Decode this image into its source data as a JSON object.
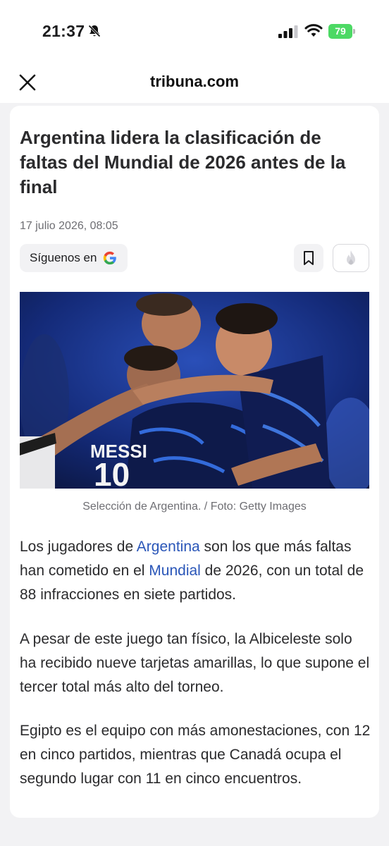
{
  "status_bar": {
    "time": "21:37",
    "battery": "79",
    "icons": [
      "bell-muted-icon",
      "cellular-signal-icon",
      "wifi-icon",
      "battery-charging-icon"
    ]
  },
  "header": {
    "close_icon": "close-icon",
    "site": "tribuna.com"
  },
  "article": {
    "title": "Argentina lidera la clasificación de faltas del Mundial de 2026 antes de la final",
    "date": "17 julio 2026, 08:05",
    "follow_label": "Síguenos en",
    "follow_icon": "google-icon",
    "bookmark_icon": "bookmark-icon",
    "reaction_icon": "fire-icon",
    "image_caption": "Selección de Argentina. / Foto: Getty Images",
    "paragraphs": {
      "p1": {
        "t1": "Los jugadores de ",
        "link1": "Argentina",
        "t2": " son los que más faltas han cometido en el ",
        "link2": "Mundial",
        "t3": " de 2026, con un total de 88 infracciones en siete partidos."
      },
      "p2": "A pesar de este juego tan físico, la Albiceleste solo ha recibido nueve tarjetas amarillas, lo que supone el tercer total más alto del torneo.",
      "p3": "Egipto es el equipo con más amonestaciones, con 12 en cinco partidos, mientras que Canadá ocupa el segundo lugar con 11 en cinco encuentros."
    }
  },
  "colors": {
    "link": "#2a56b8",
    "battery": "#4cd964",
    "background": "#f2f2f4"
  }
}
